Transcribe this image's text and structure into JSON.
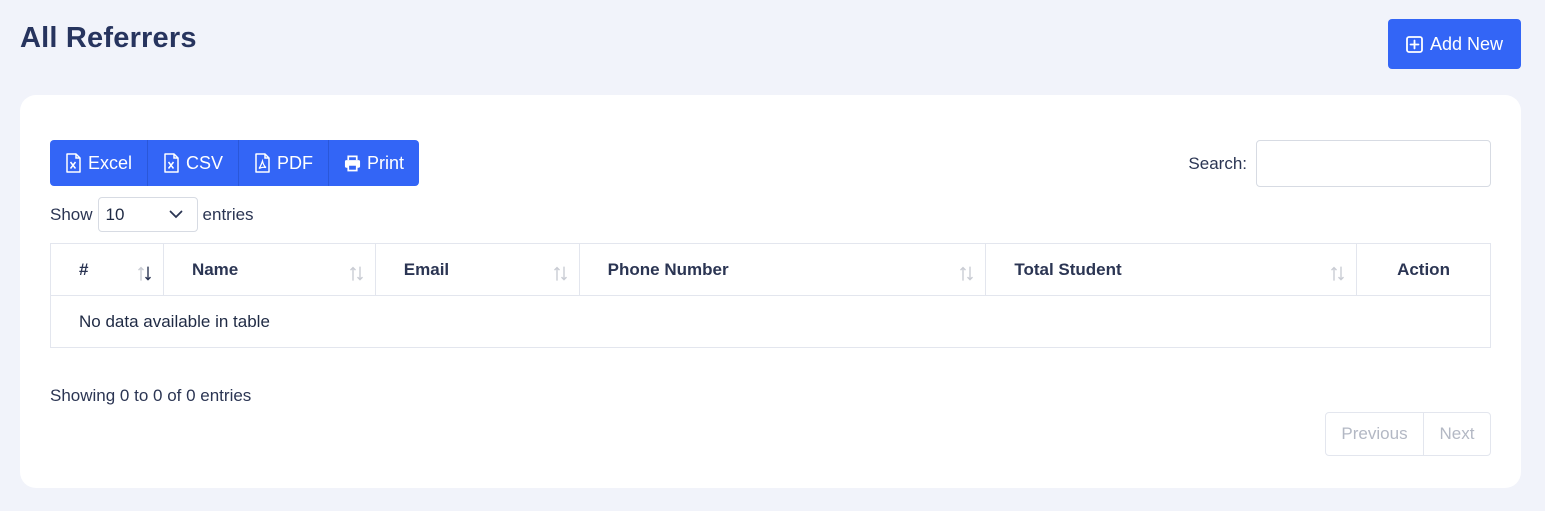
{
  "header": {
    "title": "All Referrers",
    "add_button": "Add New"
  },
  "toolbar": {
    "exports": [
      {
        "label": "Excel",
        "icon": "excel-file-icon"
      },
      {
        "label": "CSV",
        "icon": "csv-file-icon"
      },
      {
        "label": "PDF",
        "icon": "pdf-file-icon"
      },
      {
        "label": "Print",
        "icon": "printer-icon"
      }
    ],
    "search_label": "Search:",
    "search_value": ""
  },
  "length": {
    "prefix": "Show",
    "value": "10",
    "suffix": "entries"
  },
  "table": {
    "columns": [
      "#",
      "Name",
      "Email",
      "Phone Number",
      "Total Student",
      "Action"
    ],
    "empty_message": "No data available in table"
  },
  "footer": {
    "info": "Showing 0 to 0 of 0 entries",
    "previous": "Previous",
    "next": "Next"
  },
  "colors": {
    "accent": "#3365f6",
    "background": "#f1f3fa",
    "title": "#27345e"
  }
}
